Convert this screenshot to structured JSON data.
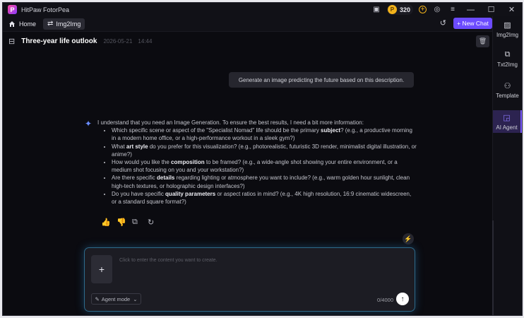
{
  "app": {
    "title": "HitPaw FotorPea",
    "coins": "320"
  },
  "nav": {
    "home_label": "Home",
    "tab_label": "Img2Img",
    "new_chat_label": "+ New Chat"
  },
  "sidebar": {
    "items": [
      {
        "label": "Img2Img",
        "icon": "image-icon",
        "active": false
      },
      {
        "label": "Txt2Img",
        "icon": "text-image-icon",
        "active": false
      },
      {
        "label": "Template",
        "icon": "template-icon",
        "active": false
      },
      {
        "label": "AI Agent",
        "icon": "ai-agent-icon",
        "active": true
      }
    ]
  },
  "chat": {
    "title": "Three-year life outlook",
    "date": "2026-05-21",
    "time": "14:44",
    "user_message": "Generate an image predicting the future based on this description.",
    "ai_intro": "I understand that you need an Image Generation. To ensure the best results, I need a bit more information:",
    "ai_points": [
      {
        "pre": "Which specific scene or aspect of the \"Specialist Nomad\" life should be the primary ",
        "bold": "subject",
        "post": "? (e.g., a productive morning in a modern home office, or a high-performance workout in a sleek gym?)"
      },
      {
        "pre": "What ",
        "bold": "art style",
        "post": " do you prefer for this visualization? (e.g., photorealistic, futuristic 3D render, minimalist digital illustration, or anime?)"
      },
      {
        "pre": "How would you like the ",
        "bold": "composition",
        "post": " to be framed? (e.g., a wide-angle shot showing your entire environment, or a medium shot focusing on you and your workstation?)"
      },
      {
        "pre": "Are there specific ",
        "bold": "details",
        "post": " regarding lighting or atmosphere you want to include? (e.g., warm golden hour sunlight, clean high-tech textures, or holographic design interfaces?)"
      },
      {
        "pre": "Do you have specific ",
        "bold": "quality parameters",
        "post": " or aspect ratios in mind? (e.g., 4K high resolution, 16:9 cinematic widescreen, or a standard square format?)"
      }
    ]
  },
  "input": {
    "placeholder": "Click to enter the content you want to create.",
    "mode_label": "Agent mode",
    "counter": "0/4000"
  },
  "colors": {
    "accent": "#6c4bff",
    "coin": "#f2b21b",
    "glow": "#2d6a8a"
  }
}
